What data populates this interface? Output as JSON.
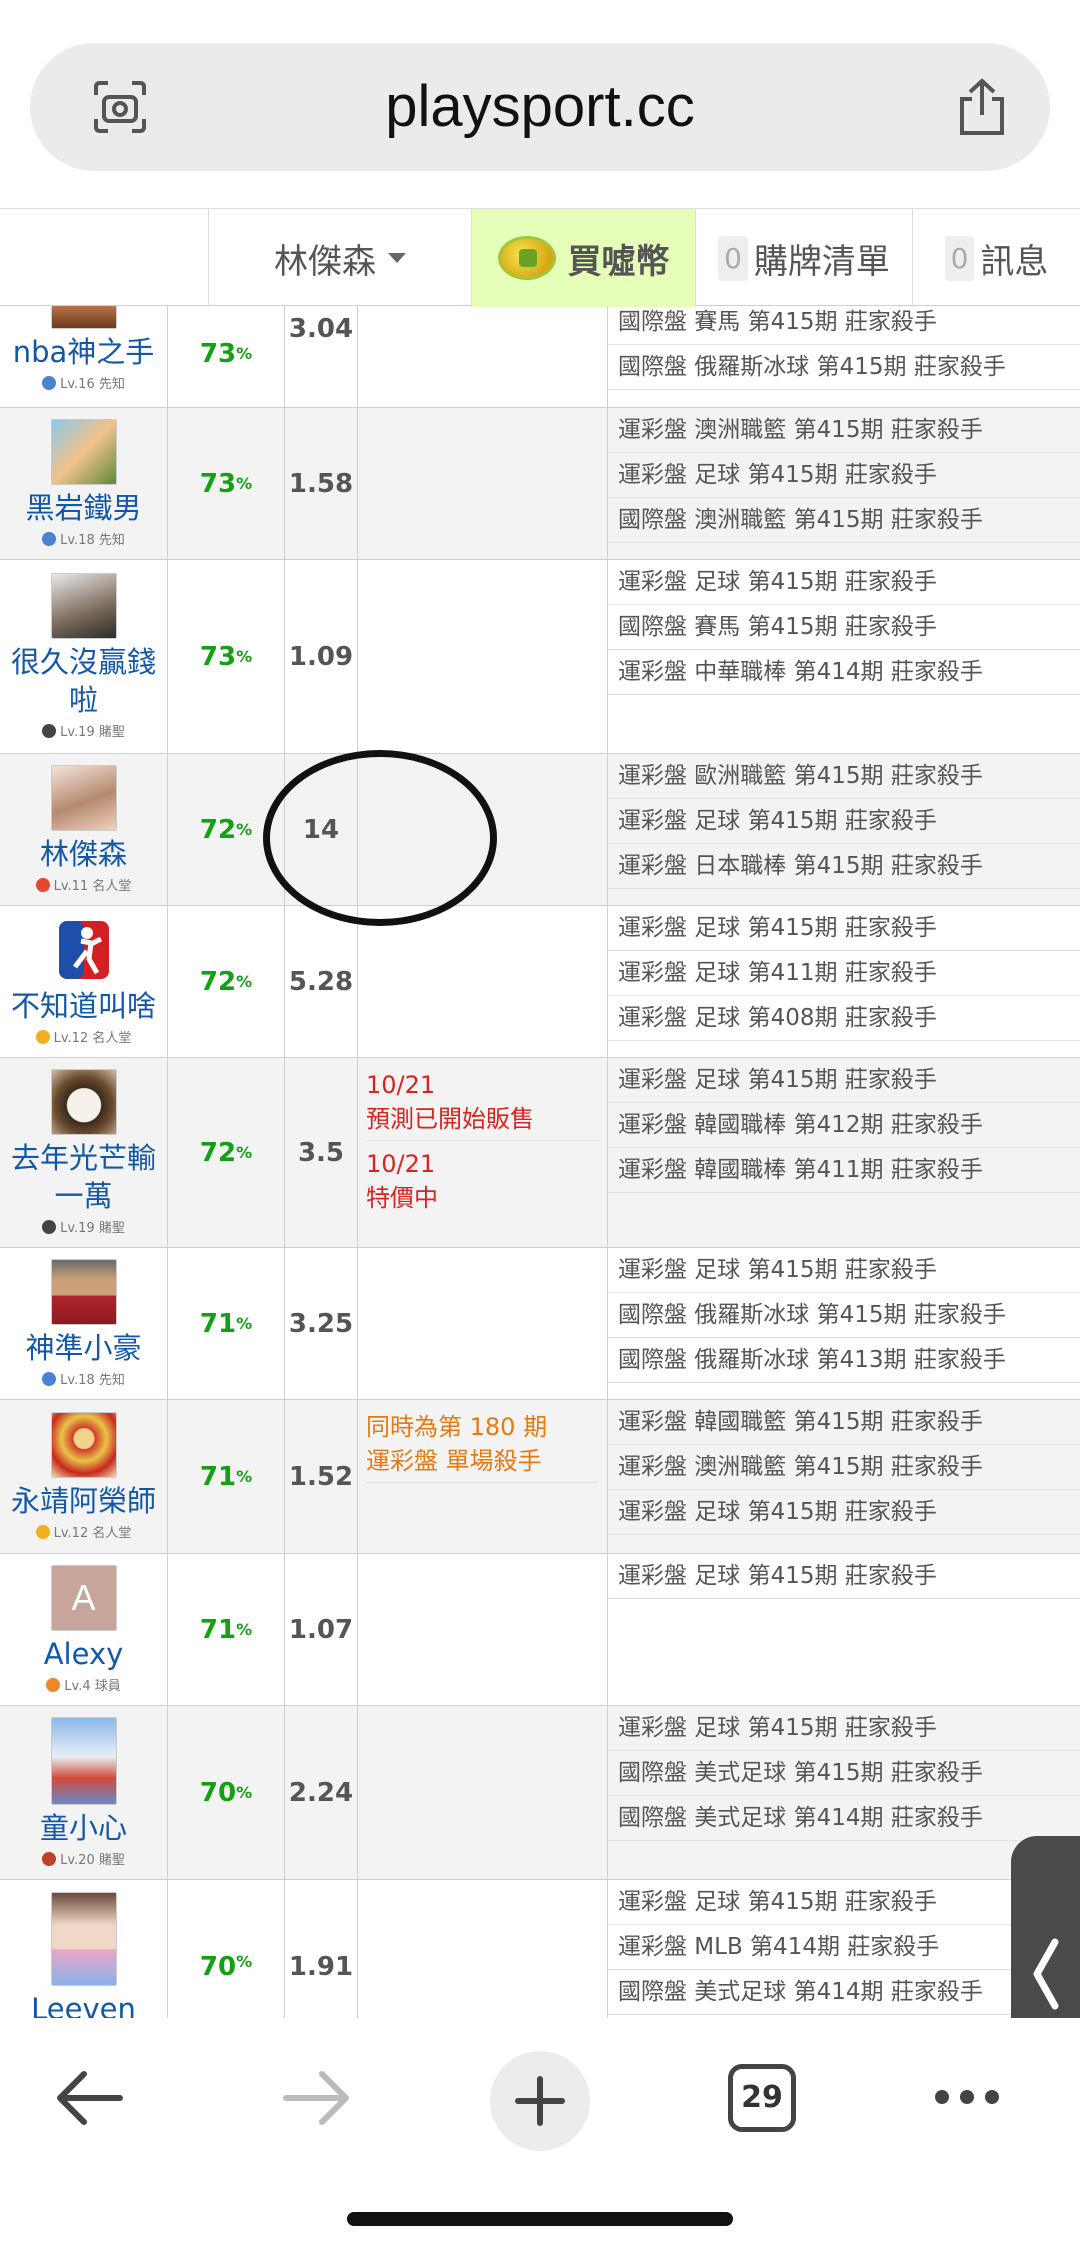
{
  "browser": {
    "url": "playsport.cc",
    "open_tabs": "29"
  },
  "header": {
    "user": "林傑森",
    "buy": "買噓幣",
    "list_count": "0",
    "list_label": "購牌清單",
    "msg_count": "0",
    "msg_label": "訊息"
  },
  "rows": [
    {
      "name": "nba神之手",
      "level": "Lv.16 先知",
      "rate": "73",
      "odds": "3.04",
      "note": [],
      "items": [
        "國際盤 賽馬 第415期 莊家殺手",
        "國際盤 俄羅斯冰球 第415期 莊家殺手"
      ]
    },
    {
      "name": "黑岩鐵男",
      "level": "Lv.18 先知",
      "rate": "73",
      "odds": "1.58",
      "note": [],
      "items": [
        "運彩盤 澳洲職籃 第415期 莊家殺手",
        "運彩盤 足球 第415期 莊家殺手",
        "國際盤 澳洲職籃 第415期 莊家殺手"
      ]
    },
    {
      "name": "很久沒贏錢啦",
      "level": "Lv.19 賭聖",
      "rate": "73",
      "odds": "1.09",
      "note": [],
      "items": [
        "運彩盤 足球 第415期 莊家殺手",
        "國際盤 賽馬 第415期 莊家殺手",
        "運彩盤 中華職棒 第414期 莊家殺手"
      ]
    },
    {
      "name": "林傑森",
      "level": "Lv.11 名人堂",
      "rate": "72",
      "odds": "14",
      "note": [],
      "items": [
        "運彩盤 歐洲職籃 第415期 莊家殺手",
        "運彩盤 足球 第415期 莊家殺手",
        "運彩盤 日本職棒 第415期 莊家殺手"
      ]
    },
    {
      "name": "不知道叫啥",
      "level": "Lv.12 名人堂",
      "rate": "72",
      "odds": "5.28",
      "note": [],
      "items": [
        "運彩盤 足球 第415期 莊家殺手",
        "運彩盤 足球 第411期 莊家殺手",
        "運彩盤 足球 第408期 莊家殺手"
      ]
    },
    {
      "name": "去年光芒輸一萬",
      "level": "Lv.19 賭聖",
      "rate": "72",
      "odds": "3.5",
      "note": [
        "10/21",
        "預測已開始販售",
        "10/21",
        "特價中"
      ],
      "items": [
        "運彩盤 足球 第415期 莊家殺手",
        "運彩盤 韓國職棒 第412期 莊家殺手",
        "運彩盤 韓國職棒 第411期 莊家殺手"
      ]
    },
    {
      "name": "神準小豪",
      "level": "Lv.18 先知",
      "rate": "71",
      "odds": "3.25",
      "note": [],
      "items": [
        "運彩盤 足球 第415期 莊家殺手",
        "國際盤 俄羅斯冰球 第415期 莊家殺手",
        "國際盤 俄羅斯冰球 第413期 莊家殺手"
      ]
    },
    {
      "name": "永靖阿榮師",
      "level": "Lv.12 名人堂",
      "rate": "71",
      "odds": "1.52",
      "note": [
        "同時為第 180 期",
        "運彩盤 單場殺手"
      ],
      "items": [
        "運彩盤 韓國職籃 第415期 莊家殺手",
        "運彩盤 澳洲職籃 第415期 莊家殺手",
        "運彩盤 足球 第415期 莊家殺手"
      ]
    },
    {
      "name": "Alexy",
      "avatar_letter": "A",
      "level": "Lv.4 球員",
      "rate": "71",
      "odds": "1.07",
      "note": [],
      "items": [
        "運彩盤 足球 第415期 莊家殺手"
      ]
    },
    {
      "name": "童小心",
      "level": "Lv.20 賭聖",
      "rate": "70",
      "odds": "2.24",
      "note": [],
      "items": [
        "運彩盤 足球 第415期 莊家殺手",
        "國際盤 美式足球 第415期 莊家殺手",
        "國際盤 美式足球 第414期 莊家殺手"
      ]
    },
    {
      "name": "Leeven",
      "level": "",
      "rate": "70",
      "odds": "1.91",
      "note": [],
      "items": [
        "運彩盤 足球 第415期 莊家殺手",
        "運彩盤 MLB 第414期 莊家殺手",
        "國際盤 美式足球 第414期 莊家殺手"
      ]
    }
  ],
  "colors": {
    "rate_green": "#14a014",
    "name_blue": "#1358a8",
    "note_red": "#d8231e",
    "note_orange": "#e57a11",
    "buy_bg": "#e6ffb8"
  },
  "icons": {
    "lens": "camera-lens-icon",
    "share": "share-icon",
    "back": "back-arrow-icon",
    "forward": "forward-arrow-icon",
    "new_tab": "plus-icon",
    "tabs": "tabs-icon",
    "more": "more-icon",
    "side_tab": "chevron-left-icon",
    "coin": "coin-icon"
  }
}
